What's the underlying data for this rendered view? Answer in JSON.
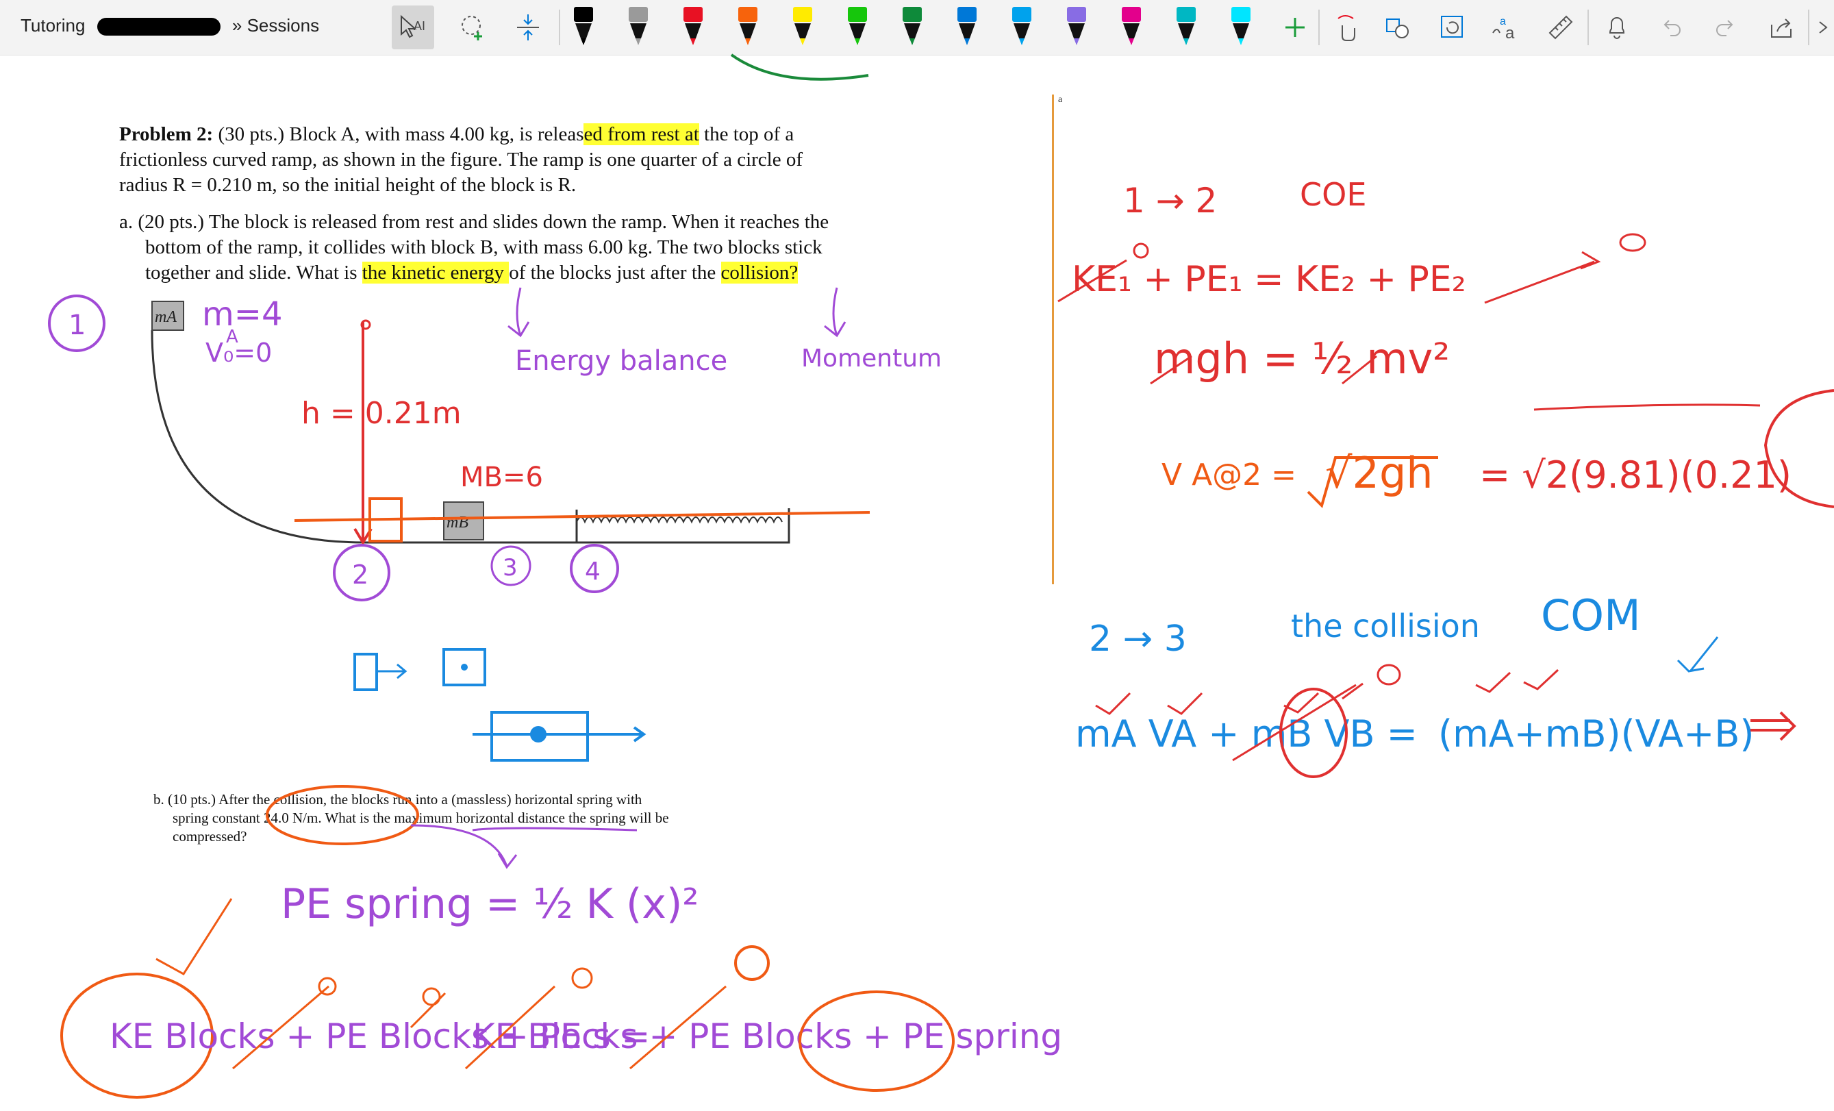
{
  "breadcrumb": {
    "root": "Tutoring",
    "separator": "»",
    "current": "Sessions"
  },
  "toolbar": {
    "text_tool_label": "AI",
    "pens": [
      {
        "name": "black-pen",
        "color": "#000000"
      },
      {
        "name": "gray-pen",
        "color": "#9a9a9a"
      },
      {
        "name": "red-pen",
        "color": "#e81123"
      },
      {
        "name": "orange-pen",
        "color": "#f7630c"
      },
      {
        "name": "yellow-pen",
        "color": "#ffeb00"
      },
      {
        "name": "green-pen",
        "color": "#16c60c"
      },
      {
        "name": "darkgreen-pen",
        "color": "#0e8a3a"
      },
      {
        "name": "blue-pen",
        "color": "#0078d7"
      },
      {
        "name": "lightblue-pen",
        "color": "#00a2ed"
      },
      {
        "name": "purple-pen",
        "color": "#886ce4"
      },
      {
        "name": "pink-pen",
        "color": "#e3008c"
      },
      {
        "name": "cyan-pen",
        "color": "#00b7c3"
      },
      {
        "name": "highlighter",
        "color": "#00e5ff"
      }
    ]
  },
  "problem": {
    "header": "Problem 2:",
    "line1a": " (30 pts.) Block A, with mass 4.00 kg, is releas",
    "line1b": "ed from rest at",
    "line1c": " the top of a",
    "line2": "frictionless curved ramp, as shown in the figure. The ramp is one quarter of a circle of",
    "line3": "radius R = 0.210 m, so the initial height of the block is R.",
    "a1": "a. (20 pts.) The block is released from rest and slides down the ramp. When it reaches the",
    "a2": "bottom of the ramp, it collides with block B, with mass 6.00 kg. The two blocks stick",
    "a3a": "together and slide. What is ",
    "a3b": "the kinetic energy ",
    "a3c": "of the blocks just after the ",
    "a3d": "collision?",
    "b1": "b. (10 pts.) After the collision, the blocks run into a (massless) horizontal spring with",
    "b2": "spring constant 24.0 N/m. What is the maximum horizontal distance the spring will be",
    "b3": "compressed?",
    "mA": "mA",
    "mB": "mB",
    "small_a": "a"
  },
  "annotations": {
    "left": {
      "c1": "1",
      "c2": "2",
      "c3": "3",
      "c4": "4",
      "mA": "m=4",
      "mA_sub": "A",
      "v0": "V₀=0",
      "h": "h = 0.21m",
      "mB": "MB=6",
      "energy": "Energy balance",
      "momentum": "Momentum",
      "pe_spring": "PE spring = ½ K (x)²",
      "eq_bottom_1": "KE Blocks + PE Blocks + PE s =",
      "eq_bottom_2": "KE Blocks + PE Blocks + PE spring"
    },
    "right": {
      "step1": "1 → 2",
      "coe": "COE",
      "eq1": "KE₁ + PE₁ = KE₂ + PE₂",
      "eq2": "mgh = ½ mv²",
      "eq3_lhs": "V A@2 =",
      "eq3_mid": "√2gh",
      "eq3_rhs": "= √2(9.81)(0.21)",
      "step2": "2 → 3",
      "collision": "the collision",
      "com": "COM",
      "eq4_lhs": "mA VA + mB VB =",
      "eq4_rhs": "(mA+mB)(VA+B)"
    }
  }
}
